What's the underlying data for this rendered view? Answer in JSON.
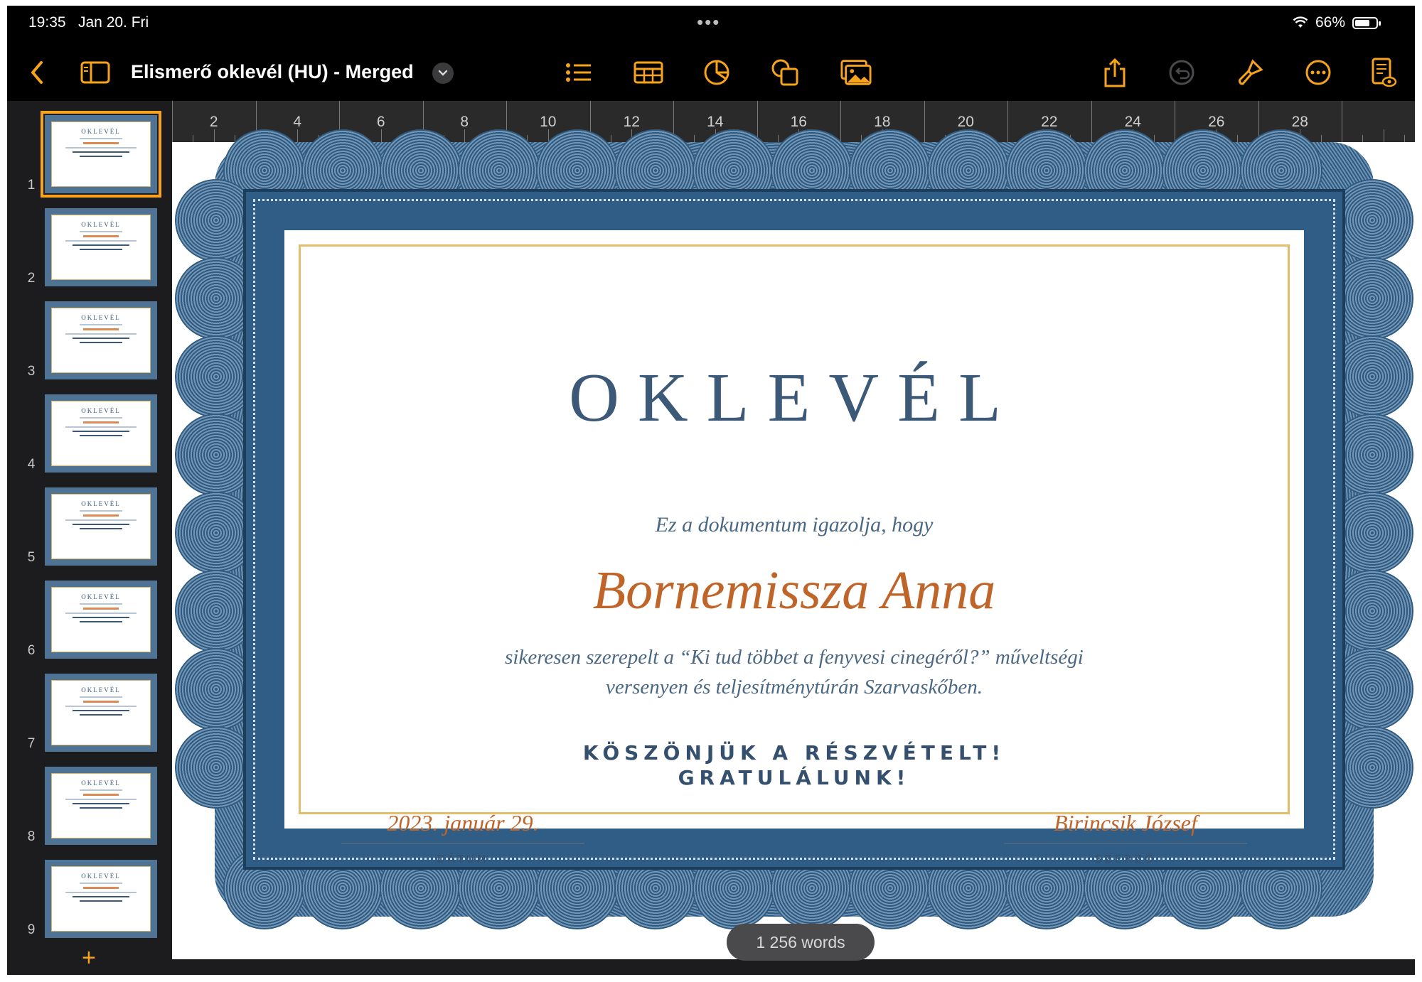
{
  "status_bar": {
    "time": "19:35",
    "date": "Jan 20. Fri",
    "battery": "66%"
  },
  "toolbar": {
    "document_title": "Elismerő oklevél (HU) - Merged",
    "accent_color": "#f7a31c"
  },
  "ruler": {
    "labels": [
      "2",
      "4",
      "6",
      "8",
      "10",
      "12",
      "14",
      "16",
      "18",
      "20",
      "22",
      "24",
      "26",
      "28"
    ]
  },
  "sidebar": {
    "pages": [
      {
        "number": "1",
        "selected": true
      },
      {
        "number": "2",
        "selected": false
      },
      {
        "number": "3",
        "selected": false
      },
      {
        "number": "4",
        "selected": false
      },
      {
        "number": "5",
        "selected": false
      },
      {
        "number": "6",
        "selected": false
      },
      {
        "number": "7",
        "selected": false
      },
      {
        "number": "8",
        "selected": false
      },
      {
        "number": "9",
        "selected": false
      }
    ],
    "thumb_title": "OKLEVÉL"
  },
  "certificate": {
    "title": "OKLEVÉL",
    "intro": "Ez a dokumentum igazolja, hogy",
    "name": "Bornemissza Anna",
    "body_line1": "sikeresen szerepelt a “Ki tud többet a fenyvesi cinegéről?” műveltségi",
    "body_line2": "versenyen és teljesítménytúrán Szarvaskőben.",
    "thanks_line1": "KÖSZÖNJÜK A RÉSZVÉTELT!",
    "thanks_line2": "GRATULÁLUNK!",
    "date_value": "2023. január 29.",
    "date_label": "DÁTUM",
    "author_value": "Birincsik József",
    "author_label": "SZERZŐ"
  },
  "word_count": "1 256 words"
}
